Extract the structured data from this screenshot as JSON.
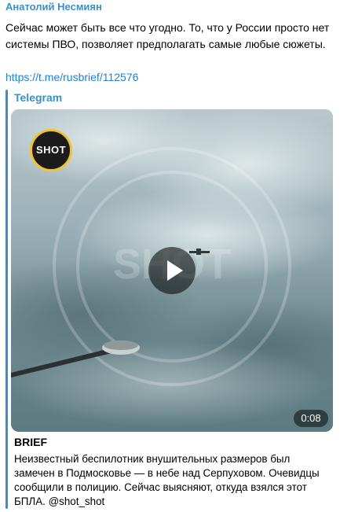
{
  "message": {
    "author": "Анатолий Несмиян",
    "text": "Сейчас может быть все что угодно. То, что у России просто нет системы ПВО, позволяет предполагать самые любые сюжеты.",
    "link": "https://t.me/rusbrief/112576"
  },
  "preview": {
    "site_name": "Telegram",
    "logo_text": "SHOT",
    "watermark_text": "SHOT",
    "duration": "0:08",
    "title": "BRIEF",
    "description": "Неизвестный беспилотник внушительных размеров был замечен в Подмосковье — в небе над Серпуховом. Очевидцы сообщили в полицию. Сейчас выясняют, откуда взялся этот БПЛА. @shot_shot"
  },
  "colors": {
    "accent": "#3a8fc8",
    "link": "#2481cc"
  },
  "icons": {
    "play": "play-icon",
    "logo": "shot-logo-icon"
  }
}
